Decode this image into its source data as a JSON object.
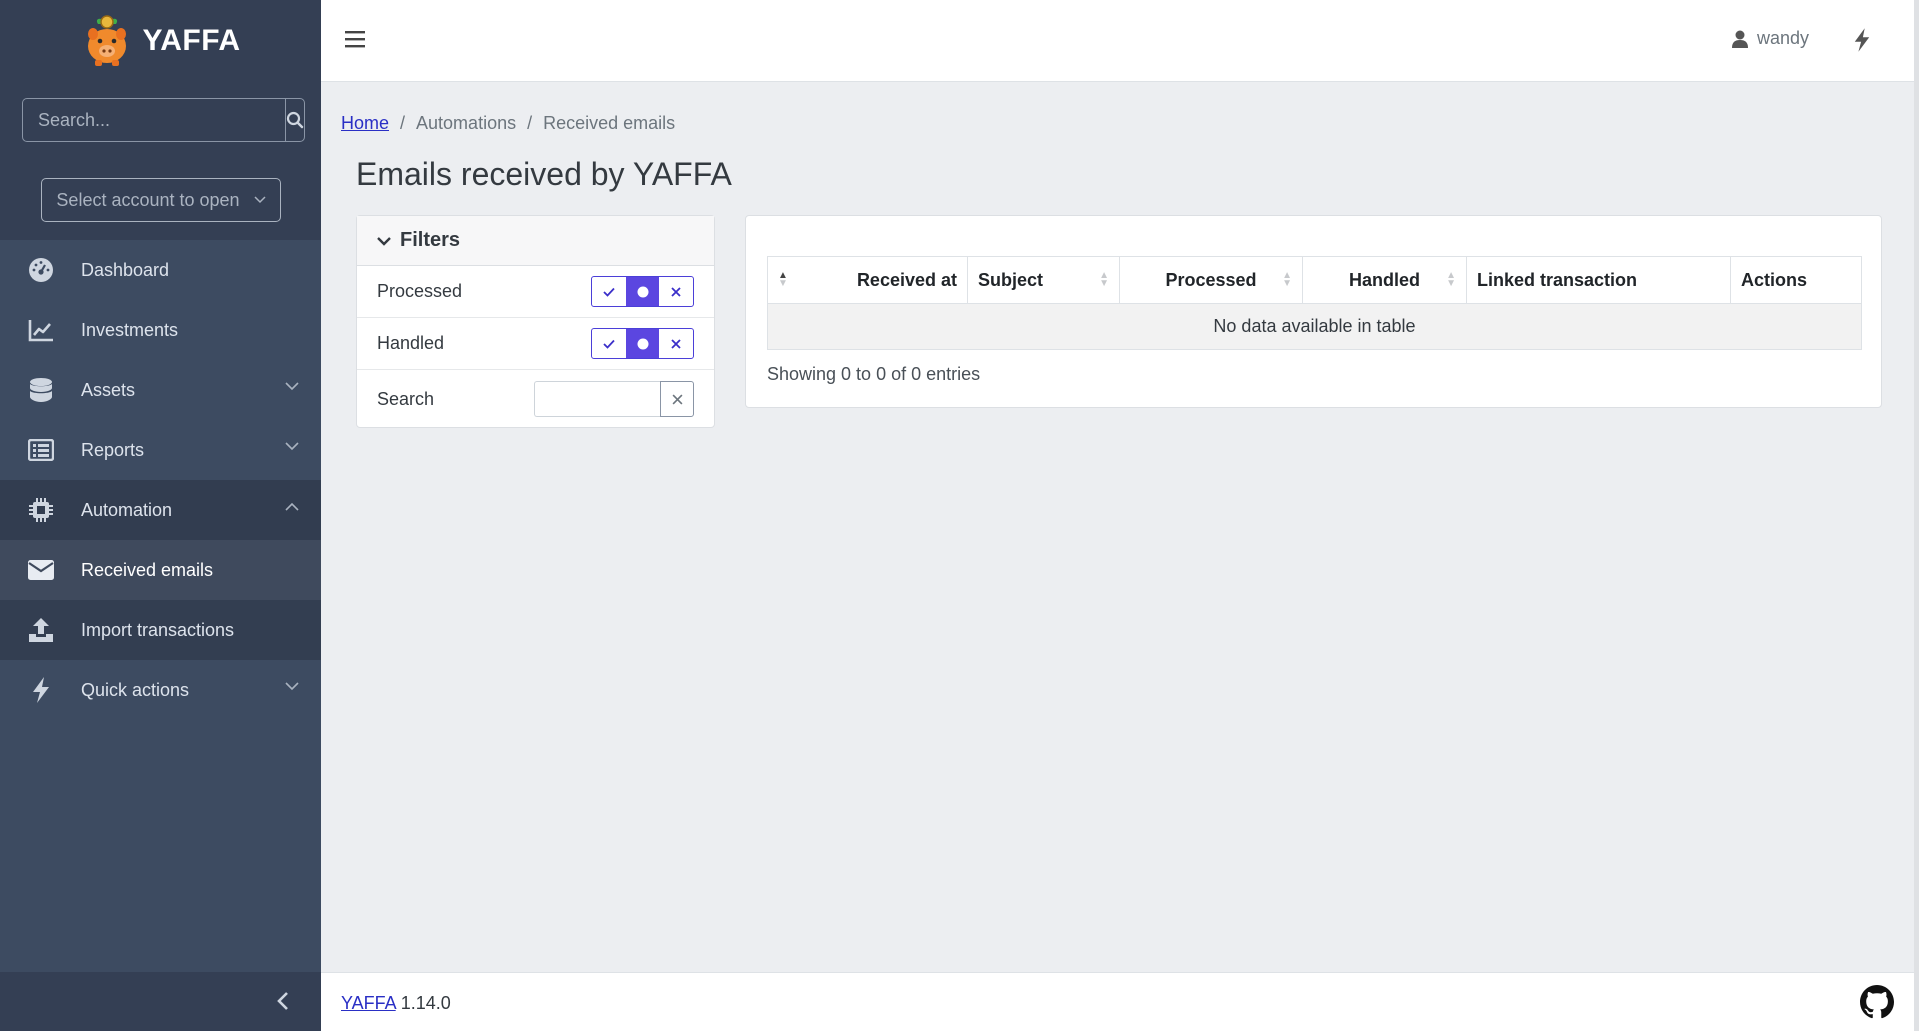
{
  "brand": {
    "name": "YAFFA"
  },
  "sidebar": {
    "search_placeholder": "Search...",
    "account_select": "Select account to open",
    "items": [
      {
        "label": "Dashboard",
        "icon": "gauge-icon"
      },
      {
        "label": "Investments",
        "icon": "chart-line-icon"
      },
      {
        "label": "Assets",
        "icon": "database-icon"
      },
      {
        "label": "Reports",
        "icon": "list-icon"
      },
      {
        "label": "Automation",
        "icon": "chip-icon"
      },
      {
        "label": "Received emails",
        "icon": "envelope-icon"
      },
      {
        "label": "Import transactions",
        "icon": "upload-icon"
      },
      {
        "label": "Quick actions",
        "icon": "bolt-icon"
      }
    ]
  },
  "topbar": {
    "user": "wandy"
  },
  "breadcrumb": {
    "home": "Home",
    "section": "Automations",
    "current": "Received emails",
    "separator": "/"
  },
  "page": {
    "title": "Emails received by YAFFA"
  },
  "filters": {
    "title": "Filters",
    "processed_label": "Processed",
    "handled_label": "Handled",
    "search_label": "Search",
    "search_value": ""
  },
  "table": {
    "columns": [
      "Received at",
      "Subject",
      "Processed",
      "Handled",
      "Linked transaction",
      "Actions"
    ],
    "empty_message": "No data available in table",
    "info": "Showing 0 to 0 of 0 entries"
  },
  "footer": {
    "link": "YAFFA",
    "version": "1.14.0"
  },
  "colors": {
    "sidebar": "#3d4b61",
    "accent": "#5b46e0",
    "link": "#2a2fc5"
  }
}
